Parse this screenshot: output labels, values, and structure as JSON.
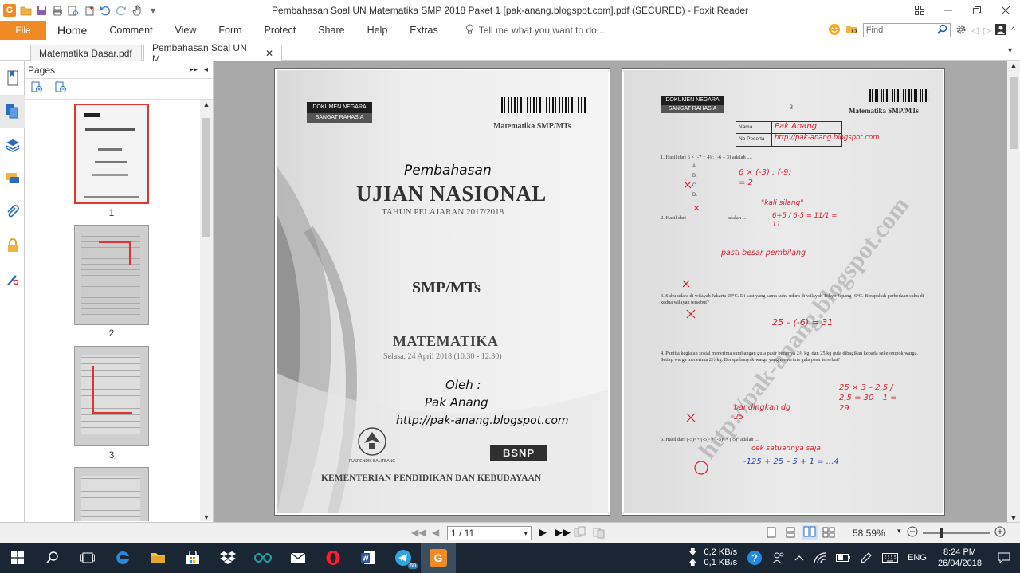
{
  "window": {
    "title": "Pembahasan Soal UN Matematika SMP 2018 Paket 1 [pak-anang.blogspot.com].pdf (SECURED) - Foxit Reader",
    "app_logo": "G"
  },
  "ribbon": {
    "file": "File",
    "tabs": [
      "Home",
      "Comment",
      "View",
      "Form",
      "Protect",
      "Share",
      "Help",
      "Extras"
    ],
    "tell_me": "Tell me what you want to do...",
    "find_placeholder": "Find"
  },
  "doc_tabs": [
    {
      "label": "Matematika Dasar.pdf"
    },
    {
      "label": "Pembahasan Soal UN M..."
    }
  ],
  "pages_panel": {
    "title": "Pages",
    "thumbnails": [
      {
        "label": "1"
      },
      {
        "label": "2"
      },
      {
        "label": "3"
      }
    ]
  },
  "cover_page": {
    "badge_top": "DOKUMEN NEGARA",
    "badge_bottom": "SANGAT RAHASIA",
    "header_right": "Matematika SMP/MTs",
    "handwritten_title": "Pembahasan",
    "title": "UJIAN NASIONAL",
    "subtitle": "TAHUN PELAJARAN 2017/2018",
    "level": "SMP/MTs",
    "subject": "MATEMATIKA",
    "schedule": "Selasa, 24 April 2018 (10.30 - 12.30)",
    "by_label": "Oleh :",
    "author": "Pak Anang",
    "url": "http://pak-anang.blogspot.com",
    "logo_left": "PUSPENDIK BALITBANG",
    "logo_right": "BSNP",
    "footer": "KEMENTERIAN PENDIDIKAN DAN KEBUDAYAAN"
  },
  "page_two": {
    "badge_top": "DOKUMEN NEGARA",
    "badge_bottom": "SANGAT RAHASIA",
    "page_number": "3",
    "header_right": "Matematika SMP/MTs",
    "name_label": "Nama",
    "name_value": "Pak Anang",
    "peserta_label": "No Peserta",
    "peserta_value": "http://pak-anang.blogspot.com",
    "watermark": "http://pak-anang.blogspot.com",
    "q1": "1.   Hasil dari 6 × (-7 + 4) : (-6 – 3) adalah ....",
    "q1_note": "6 × (-3) : (-9) = 2",
    "q2": "2.   Hasil dari",
    "q2_tail": "adalah ....",
    "q2_note": "\"kali silang\"",
    "q2_work": "6+5 / 6-5 = 11/1 = 11",
    "q2_note2": "pasti besar pembilang",
    "q3": "3.   Suhu udara di wilayah Jakarta 25°C. Di saat yang sama suhu udara di wilayah Tokyo Jepang -6°C. Berapakah perbedaan suhu di kedua wilayah tersebut?",
    "q3_work": "25 – (-6) = 31",
    "q4": "4.   Panitia kegiatan sosial menerima sumbangan gula pasir beratnya 2¾ kg, dan 25 kg gula dibagikan kepada sekelompok warga. Setiap warga menerima 2½ kg. Berapa banyak warga yang menerima gula pasir tersebut?",
    "q4_note": "bandingkan dg 25",
    "q4_work": "25 × 3 – 2,5 / 2,5 = 30 – 1 = 29",
    "q5": "5.   Hasil dari (-5)³ + (-5)² + (-5)¹ + (-5)⁰ adalah ....",
    "q5_note": "cek satuannya saja",
    "q5_work": "-125 + 25 – 5 + 1 = ...4"
  },
  "statusbar": {
    "page_current": "1 / 11",
    "zoom": "58.59%"
  },
  "taskbar": {
    "net_down": "0,2 KB/s",
    "net_up": "0,1 KB/s",
    "lang": "ENG",
    "time": "8:24 PM",
    "date": "26/04/2018",
    "telegram_badge": "60"
  }
}
